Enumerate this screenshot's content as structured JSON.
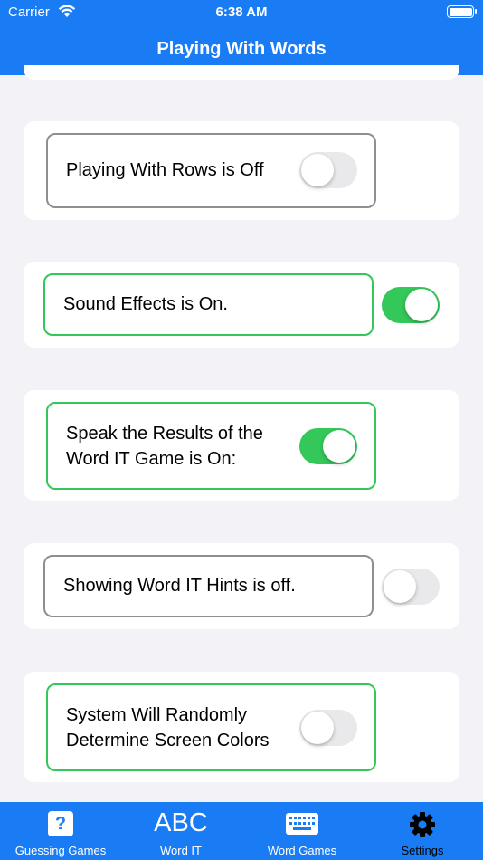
{
  "status_bar": {
    "carrier": "Carrier",
    "time": "6:38 AM"
  },
  "nav": {
    "title": "Playing With Words"
  },
  "settings": [
    {
      "label": "Playing With Rows is Off",
      "on": false,
      "highlight": "gray"
    },
    {
      "label": "Sound Effects is On.",
      "on": true,
      "highlight": "green"
    },
    {
      "label": "Speak the Results of the Word IT Game is On:",
      "on": true,
      "highlight": "green"
    },
    {
      "label": "Showing Word IT Hints is off.",
      "on": false,
      "highlight": "gray"
    },
    {
      "label": "System Will Randomly Determine Screen Colors",
      "on": false,
      "highlight": "green"
    }
  ],
  "tabs": [
    {
      "label": "Guessing Games",
      "icon": "question-icon",
      "icon_glyph": "?"
    },
    {
      "label": "Word IT",
      "icon": "abc-icon",
      "icon_glyph": "ABC"
    },
    {
      "label": "Word Games",
      "icon": "keyboard-icon"
    },
    {
      "label": "Settings",
      "icon": "gear-icon",
      "active": true
    }
  ],
  "colors": {
    "brand": "#1a7cf5",
    "toggle_on": "#34c759",
    "toggle_off": "#e9e9eb",
    "border_gray": "#8e8e93"
  }
}
